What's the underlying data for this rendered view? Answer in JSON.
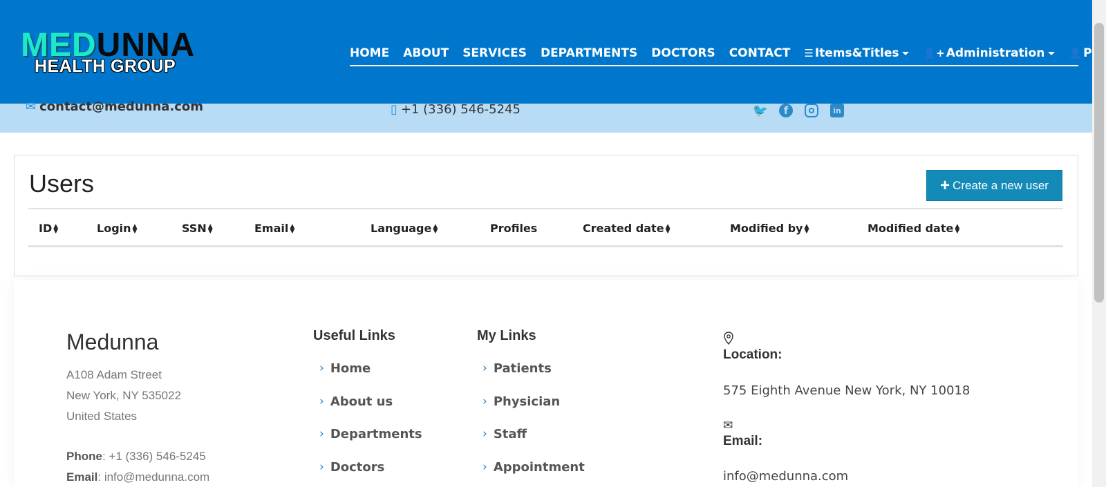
{
  "header": {
    "logo_top_a": "MED",
    "logo_top_b": "UNNA",
    "logo_bottom": "HEALTH GROUP",
    "nav": [
      {
        "label": "HOME"
      },
      {
        "label": "ABOUT"
      },
      {
        "label": "SERVICES"
      },
      {
        "label": "DEPARTMENTS"
      },
      {
        "label": "DOCTORS"
      },
      {
        "label": "CONTACT"
      },
      {
        "label": "Items&Titles",
        "icon": "list-icon"
      },
      {
        "label": "Administration",
        "icon": "user-plus-icon"
      },
      {
        "label": "Pl Ali",
        "icon": "user-icon"
      }
    ]
  },
  "topbar": {
    "email": "contact@medunna.com",
    "phone": "+1 (336) 546-5245",
    "social": [
      "twitter-icon",
      "facebook-icon",
      "instagram-icon",
      "linkedin-icon"
    ]
  },
  "users": {
    "title": "Users",
    "create_button": "Create a new user",
    "columns": [
      {
        "label": "ID",
        "sortable": true
      },
      {
        "label": "Login",
        "sortable": true
      },
      {
        "label": "SSN",
        "sortable": true
      },
      {
        "label": "Email",
        "sortable": true
      },
      {
        "label": "Language",
        "sortable": true
      },
      {
        "label": "Profiles",
        "sortable": false
      },
      {
        "label": "Created date",
        "sortable": true
      },
      {
        "label": "Modified by",
        "sortable": true
      },
      {
        "label": "Modified date",
        "sortable": true
      }
    ]
  },
  "footer": {
    "brand": "Medunna",
    "address": [
      "A108 Adam Street",
      "New York, NY 535022",
      "United States"
    ],
    "phone_label": "Phone",
    "phone": "+1 (336) 546-5245",
    "email_label": "Email",
    "email": "info@medunna.com",
    "useful_links": {
      "title": "Useful Links",
      "items": [
        "Home",
        "About us",
        "Departments",
        "Doctors"
      ]
    },
    "my_links": {
      "title": "My Links",
      "items": [
        "Patients",
        "Physician",
        "Staff",
        "Appointment"
      ]
    },
    "location_label": "Location:",
    "location": "575 Eighth Avenue New York, NY 10018",
    "contact_email_label": "Email:",
    "contact_email": "info@medunna.com"
  },
  "colors": {
    "navbar": "#0077cc",
    "topbar": "#b8dcf6",
    "button": "#138ab7",
    "link_chevron": "#1e7fc4"
  }
}
